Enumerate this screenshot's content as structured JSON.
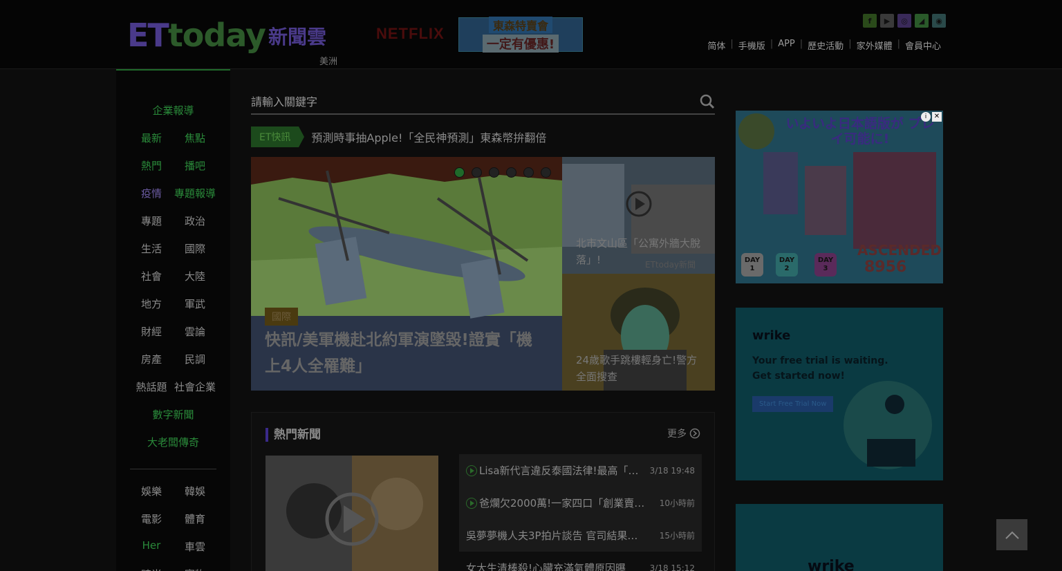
{
  "header": {
    "logo_et": "ET",
    "logo_today": "today",
    "logo_cn": "新聞雲",
    "logo_sub": "美洲",
    "netflix": "NETFLIX",
    "banner_line1": "東森特賣會",
    "banner_line2": "一定有優惠!",
    "social": [
      {
        "icon": "facebook-icon",
        "glyph": "f",
        "color": "#2a4a1a"
      },
      {
        "icon": "youtube-icon",
        "glyph": "▶",
        "color": "#3a3a3a"
      },
      {
        "icon": "instagram-icon",
        "glyph": "◎",
        "color": "#3a2a5a"
      },
      {
        "icon": "rss-icon",
        "glyph": "◢",
        "color": "#2a5a2a"
      },
      {
        "icon": "line-icon",
        "glyph": "◉",
        "color": "#2a4a4a"
      }
    ],
    "links": [
      "简体",
      "手機版",
      "APP",
      "歷史活動",
      "家外媒體",
      "會員中心"
    ]
  },
  "nav": {
    "corporate": "企業報導",
    "pairs": [
      [
        "最新",
        "焦點"
      ],
      [
        "熱門",
        "播吧"
      ],
      [
        "疫情",
        "專題報導"
      ],
      [
        "專題",
        "政治"
      ],
      [
        "生活",
        "國際"
      ],
      [
        "社會",
        "大陸"
      ],
      [
        "地方",
        "軍武"
      ],
      [
        "財經",
        "雲論"
      ],
      [
        "房產",
        "民調"
      ],
      [
        "熱話題",
        "社會企業"
      ]
    ],
    "digital": "數字新聞",
    "boss": "大老闆傳奇",
    "pairs2": [
      [
        "娛樂",
        "韓娛"
      ],
      [
        "電影",
        "體育"
      ],
      [
        "Her",
        "車雲"
      ],
      [
        "時尚",
        "寵物"
      ]
    ]
  },
  "search": {
    "placeholder": "請輸入關鍵字"
  },
  "flash": {
    "tag": "ET快訊",
    "text": "預測時事抽Apple!「全民神預測」東森幣拚翻倍"
  },
  "hero": {
    "category": "國際",
    "title": "快訊/美軍機赴北約軍演墜毀!證實「機上4人全罹難」",
    "dots": 6,
    "active_dot": 0
  },
  "side_stories": [
    {
      "caption": "北市文山區「公寓外牆大脫落」!",
      "watermark": "ETtoday新聞"
    },
    {
      "caption": "24歲歌手跳樓輕身亡!警方全面搜查"
    }
  ],
  "hot": {
    "title": "熱門新聞",
    "more": "更多",
    "items": [
      {
        "text": "Lisa新代言違反泰國法律!最高「…",
        "time": "3/18 19:48",
        "video": true
      },
      {
        "text": "爸爛欠2000萬!一家四口「創業賣…",
        "time": "10小時前",
        "video": true
      },
      {
        "text": "吳夢夢機人夫3P拍片談告 官司結果…",
        "time": "15小時前",
        "video": false
      },
      {
        "text": "女大生清棒殺!心臟充滿氣體原因曝",
        "time": "3/18 15:12",
        "video": false
      }
    ]
  },
  "ads": {
    "ad1": {
      "jp": "いよいよ日本語版が プレイ可能に!",
      "ascended": "ASCENDED",
      "number": "8956",
      "days": [
        "DAY 1",
        "DAY 2",
        "DAY 3"
      ]
    },
    "ad2": {
      "brand": "wrike",
      "message": "Your free trial is waiting. Get started now!",
      "button": "Start Free Trial Now"
    },
    "ad3": {
      "brand": "wrike"
    }
  }
}
